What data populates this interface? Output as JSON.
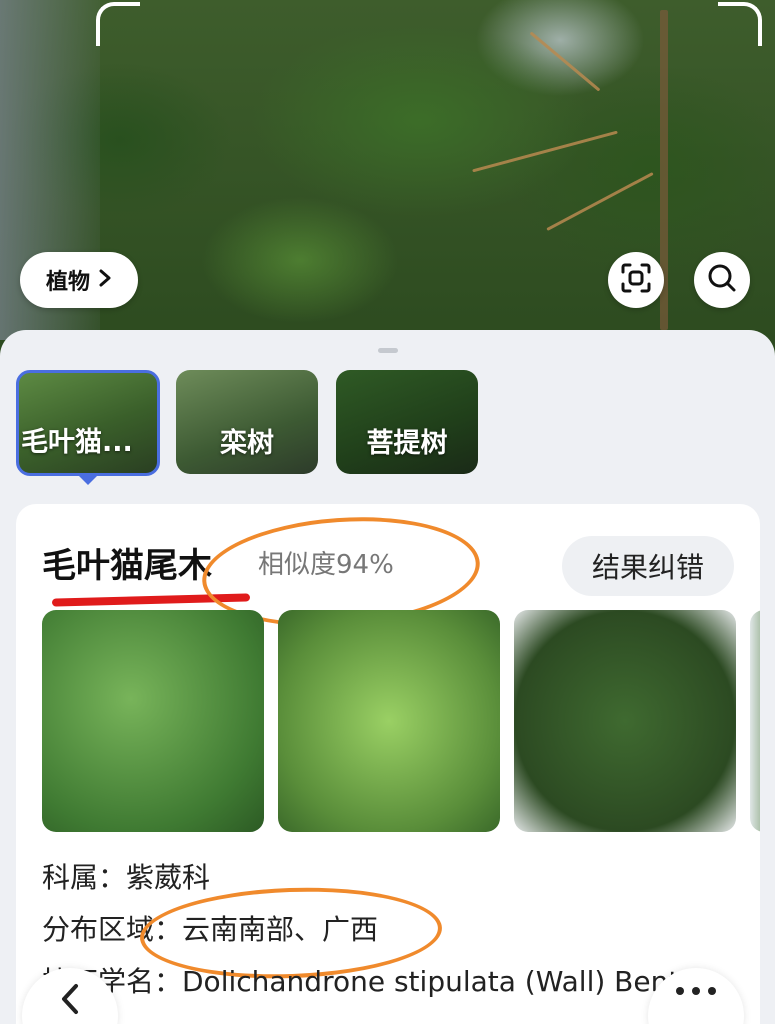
{
  "camera": {
    "category_button_label": "植物"
  },
  "results": {
    "thumbnails": [
      {
        "label": "毛叶猫...",
        "selected": true
      },
      {
        "label": "栾树",
        "selected": false
      },
      {
        "label": "菩提树",
        "selected": false
      }
    ]
  },
  "detail": {
    "name": "毛叶猫尾木",
    "similarity": "相似度94%",
    "correct_button": "结果纠错",
    "family": "科属：紫葳科",
    "distribution": "分布区域：云南南部、广西",
    "latin": "拉丁学名：Dolichandrone stipulata (Wall) Bent..."
  },
  "colors": {
    "accent": "#4a6ee0",
    "annotation_orange": "#f08a2c",
    "annotation_red": "#e01b1b"
  },
  "icons": [
    "chevron-right-icon",
    "scan-icon",
    "search-icon",
    "back-arrow-icon",
    "more-icon"
  ]
}
